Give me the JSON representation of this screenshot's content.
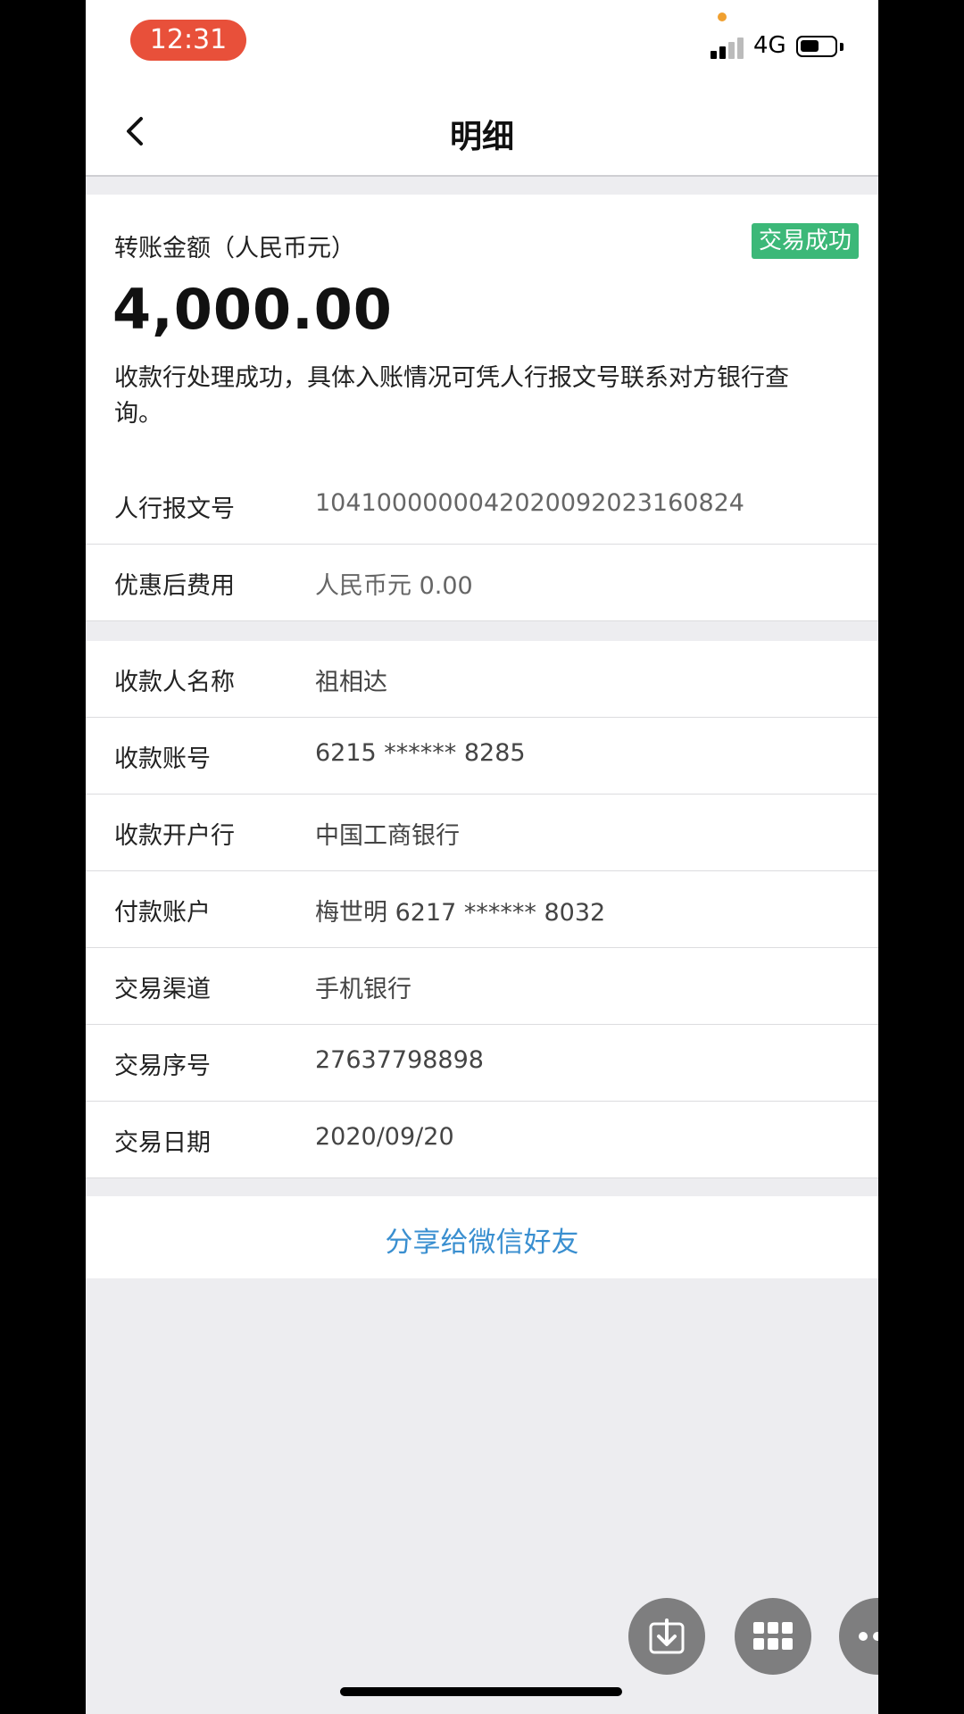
{
  "status_bar": {
    "time": "12:31",
    "network": "4G",
    "battery_level": 0.5,
    "signal_bars": 2
  },
  "nav": {
    "title": "明细",
    "back_icon": "chevron-left-icon"
  },
  "amount_card": {
    "label": "转账金额（人民币元）",
    "status": "交易成功",
    "amount": "4,000.00",
    "description": "收款行处理成功，具体入账情况可凭人行报文号联系对方银行查询。",
    "status_color": "#3cb878"
  },
  "section1": [
    {
      "label": "人行报文号",
      "value": "104100000004202009202316082​4"
    },
    {
      "label": "优惠后费用",
      "value": "人民币元 0.00"
    }
  ],
  "section2": [
    {
      "label": "收款人名称",
      "value": "祖相达"
    },
    {
      "label": "收款账号",
      "value": "6215 ****** 8285"
    },
    {
      "label": "收款开户行",
      "value": "中国工商银行"
    },
    {
      "label": "付款账户",
      "value": "梅世明 6217 ****** 8032"
    },
    {
      "label": "交易渠道",
      "value": "手机银行"
    },
    {
      "label": "交易序号",
      "value": "27637798898"
    },
    {
      "label": "交易日期",
      "value": "2020/09/20"
    }
  ],
  "share": {
    "label": "分享给微信好友",
    "color": "#3a8fd0"
  },
  "overlay_buttons": [
    "download-icon",
    "grid-icon",
    "more-icon"
  ]
}
